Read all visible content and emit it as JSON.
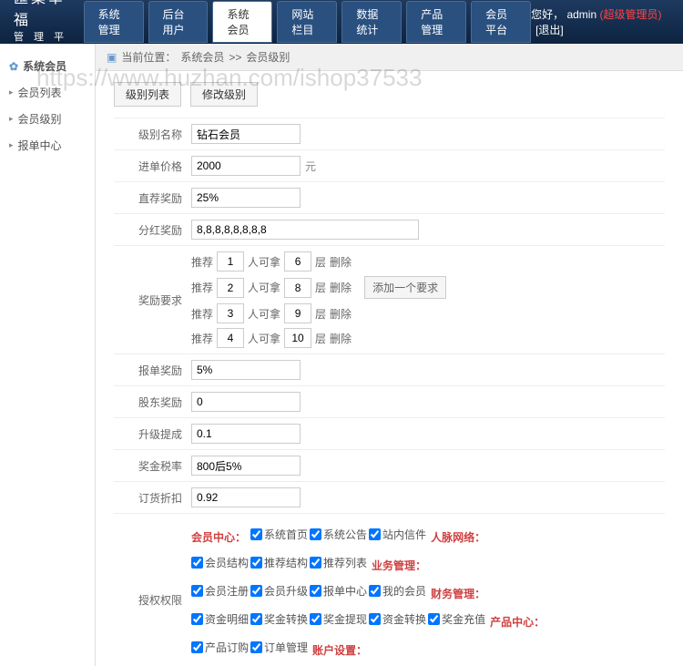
{
  "header": {
    "logo": "匯集幸福",
    "logo_sub": "管 理 平 台",
    "greeting": "您好，",
    "username": "admin",
    "role": "(超级管理员)",
    "logout": "[退出]"
  },
  "nav": [
    {
      "label": "系统管理",
      "active": false
    },
    {
      "label": "后台用户",
      "active": false
    },
    {
      "label": "系统会员",
      "active": true
    },
    {
      "label": "网站栏目",
      "active": false
    },
    {
      "label": "数据统计",
      "active": false
    },
    {
      "label": "产品管理",
      "active": false
    },
    {
      "label": "会员平台",
      "active": false
    }
  ],
  "sidebar": {
    "title": "系统会员",
    "items": [
      {
        "label": "会员列表"
      },
      {
        "label": "会员级别"
      },
      {
        "label": "报单中心"
      }
    ]
  },
  "breadcrumb": {
    "label": "当前位置：",
    "path1": "系统会员",
    "sep": ">>",
    "path2": "会员级别"
  },
  "subtabs": [
    {
      "label": "级别列表"
    },
    {
      "label": "修改级别"
    }
  ],
  "form": {
    "level_name": {
      "label": "级别名称",
      "value": "钻石会员"
    },
    "price": {
      "label": "进单价格",
      "value": "2000",
      "unit": "元"
    },
    "direct_bonus": {
      "label": "直荐奖励",
      "value": "25%"
    },
    "dividend": {
      "label": "分红奖励",
      "value": "8,8,8,8,8,8,8,8"
    },
    "tier": {
      "label": "奖励要求",
      "prefix": "推荐",
      "mid": "人可拿",
      "suffix": "层",
      "del": "删除",
      "add": "添加一个要求",
      "rows": [
        {
          "people": "1",
          "layers": "6"
        },
        {
          "people": "2",
          "layers": "8"
        },
        {
          "people": "3",
          "layers": "9"
        },
        {
          "people": "4",
          "layers": "10"
        }
      ]
    },
    "report_bonus": {
      "label": "报单奖励",
      "value": "5%"
    },
    "shareholder": {
      "label": "股东奖励",
      "value": "0"
    },
    "upgrade": {
      "label": "升级提成",
      "value": "0.1"
    },
    "tax": {
      "label": "奖金税率",
      "value": "800后5%"
    },
    "discount": {
      "label": "订货折扣",
      "value": "0.92"
    }
  },
  "permissions": {
    "label": "授权权限",
    "groups": [
      {
        "title": "会员中心：",
        "items": [
          "系统首页",
          "系统公告",
          "站内信件"
        ]
      },
      {
        "title": "人脉网络：",
        "items": [
          "会员结构",
          "推荐结构",
          "推荐列表"
        ]
      },
      {
        "title": "业务管理：",
        "items": [
          "会员注册",
          "会员升级",
          "报单中心",
          "我的会员"
        ]
      },
      {
        "title": "财务管理：",
        "items": [
          "资金明细",
          "奖金转换",
          "奖金提现",
          "资金转换",
          "奖金充值"
        ]
      },
      {
        "title": "产品中心：",
        "items": [
          "产品订购",
          "订单管理"
        ]
      },
      {
        "title": "账户设置：",
        "items": []
      }
    ]
  },
  "watermark": "https://www.huzhan.com/ishop37533"
}
